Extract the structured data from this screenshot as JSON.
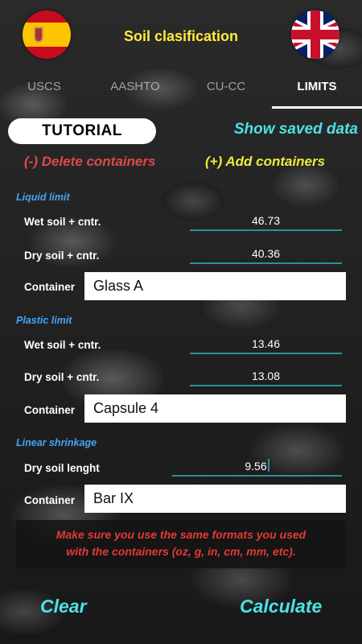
{
  "header": {
    "title": "Soil clasification",
    "left_flag": "spain-flag-icon",
    "right_flag": "uk-flag-icon"
  },
  "tabs": [
    {
      "label": "USCS",
      "active": false
    },
    {
      "label": "AASHTO",
      "active": false
    },
    {
      "label": "CU-CC",
      "active": false
    },
    {
      "label": "LIMITS",
      "active": true
    }
  ],
  "actions": {
    "tutorial": "TUTORIAL",
    "show_saved": "Show saved data",
    "delete_containers": "(-) Delete containers",
    "add_containers": "(+) Add containers"
  },
  "liquid_limit": {
    "section": "Liquid limit",
    "wet_label": "Wet soil + cntr.",
    "wet_value": "46.73",
    "dry_label": "Dry soil + cntr.",
    "dry_value": "40.36",
    "container_label": "Container",
    "container_value": "Glass A"
  },
  "plastic_limit": {
    "section": "Plastic limit",
    "wet_label": "Wet soil + cntr.",
    "wet_value": "13.46",
    "dry_label": "Dry soil + cntr.",
    "dry_value": "13.08",
    "container_label": "Container",
    "container_value": "Capsule 4"
  },
  "linear_shrinkage": {
    "section": "Linear shrinkage",
    "length_label": "Dry soil lenght",
    "length_value": "9.56",
    "container_label": "Container",
    "container_value": "Bar IX"
  },
  "warning": {
    "line1": "Make sure you use the same formats you used",
    "line2": "with the containers (oz, g, in, cm, mm, etc)."
  },
  "footer": {
    "clear": "Clear",
    "calculate": "Calculate"
  },
  "colors": {
    "title": "#ffeb3b",
    "cyan": "#4de1e6",
    "delete": "#e04848",
    "add": "#f2ea3a",
    "section": "#42a5f5",
    "warning": "#e53935"
  }
}
